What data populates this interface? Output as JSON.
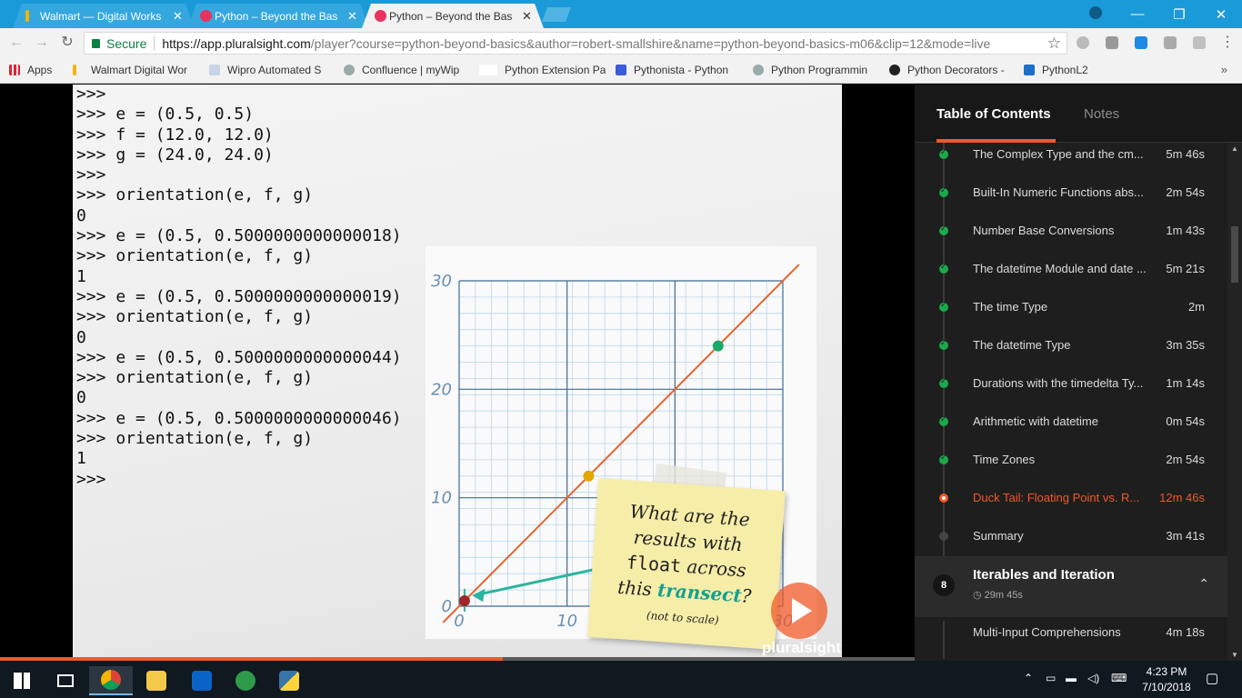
{
  "browser": {
    "tabs": [
      {
        "title": "Walmart — Digital Works",
        "active": false
      },
      {
        "title": "Python – Beyond the Bas",
        "active": false
      },
      {
        "title": "Python – Beyond the Bas",
        "active": true
      }
    ],
    "secure_label": "Secure",
    "url_host": "https://app.pluralsight.com",
    "url_rest": "/player?course=python-beyond-basics&author=robert-smallshire&name=python-beyond-basics-m06&clip=12&mode=live",
    "bookmarks": [
      {
        "label": "Apps",
        "icon": "apps-grid-icon"
      },
      {
        "label": "Walmart Digital Wor",
        "icon": "walmart-icon"
      },
      {
        "label": "Wipro Automated S",
        "icon": "document-icon"
      },
      {
        "label": "Confluence | myWip",
        "icon": "confluence-icon"
      },
      {
        "label": "Python Extension Pa",
        "icon": "lfd-icon"
      },
      {
        "label": "Pythonista - Python",
        "icon": "yc-icon"
      },
      {
        "label": "Python Programmin",
        "icon": "site-icon"
      },
      {
        "label": "Python Decorators -",
        "icon": "github-icon"
      },
      {
        "label": "PythonL2",
        "icon": "sharepoint-icon"
      }
    ],
    "bookmarks_more": "»"
  },
  "console": {
    "lines": [
      ">>>",
      ">>> e = (0.5, 0.5)",
      ">>> f = (12.0, 12.0)",
      ">>> g = (24.0, 24.0)",
      ">>>",
      ">>> orientation(e, f, g)",
      "0",
      ">>> e = (0.5, 0.5000000000000018)",
      ">>> orientation(e, f, g)",
      "1",
      ">>> e = (0.5, 0.5000000000000019)",
      ">>> orientation(e, f, g)",
      "0",
      ">>> e = (0.5, 0.5000000000000044)",
      ">>> orientation(e, f, g)",
      "0",
      ">>> e = (0.5, 0.5000000000000046)",
      ">>> orientation(e, f, g)",
      "1",
      ">>>"
    ]
  },
  "plot": {
    "x_ticks": [
      "0",
      "10",
      "30"
    ],
    "y_ticks": [
      "30",
      "20",
      "10",
      "0"
    ],
    "xlim": [
      0,
      30
    ],
    "ylim": [
      0,
      30
    ],
    "points": [
      {
        "x": 0.5,
        "y": 0.5,
        "color": "#a0262a"
      },
      {
        "x": 12.0,
        "y": 12.0,
        "color": "#e0a800"
      },
      {
        "x": 24.0,
        "y": 24.0,
        "color": "#1ba96a"
      }
    ],
    "line_color": "#e8622c",
    "accent_color": "#2bb5a0"
  },
  "note": {
    "line1": "What are the",
    "line2": "results with",
    "line3_code": "float",
    "line3_rest": " across",
    "line4_a": "this ",
    "line4_hl": "transect",
    "line4_b": "?",
    "small": "(not to scale)"
  },
  "brand": "pluralsight",
  "progress": 0.55,
  "toc": {
    "tab_contents": "Table of Contents",
    "tab_notes": "Notes",
    "clips": [
      {
        "title": "The Complex Type and the cm...",
        "duration": "5m 46s",
        "state": "done"
      },
      {
        "title": "Built-In Numeric Functions abs...",
        "duration": "2m 54s",
        "state": "done"
      },
      {
        "title": "Number Base Conversions",
        "duration": "1m 43s",
        "state": "done"
      },
      {
        "title": "The datetime Module and date ...",
        "duration": "5m 21s",
        "state": "done"
      },
      {
        "title": "The time Type",
        "duration": "2m",
        "state": "done"
      },
      {
        "title": "The datetime Type",
        "duration": "3m 35s",
        "state": "done"
      },
      {
        "title": "Durations with the timedelta Ty...",
        "duration": "1m 14s",
        "state": "done"
      },
      {
        "title": "Arithmetic with datetime",
        "duration": "0m 54s",
        "state": "done"
      },
      {
        "title": "Time Zones",
        "duration": "2m 54s",
        "state": "done"
      },
      {
        "title": "Duck Tail: Floating Point vs. R...",
        "duration": "12m 46s",
        "state": "current"
      },
      {
        "title": "Summary",
        "duration": "3m 41s",
        "state": "pending"
      }
    ],
    "module": {
      "number": "8",
      "title": "Iterables and Iteration",
      "duration": "29m 45s",
      "chevron": "⌃"
    },
    "next_clip": {
      "title": "Multi-Input Comprehensions",
      "duration": "4m 18s",
      "state": "pending"
    }
  },
  "taskbar": {
    "time": "4:23 PM",
    "date": "7/10/2018"
  },
  "colors": {
    "accent": "#f05a28",
    "done": "#1ba94c",
    "chrome_blue": "#1a9ad8"
  }
}
